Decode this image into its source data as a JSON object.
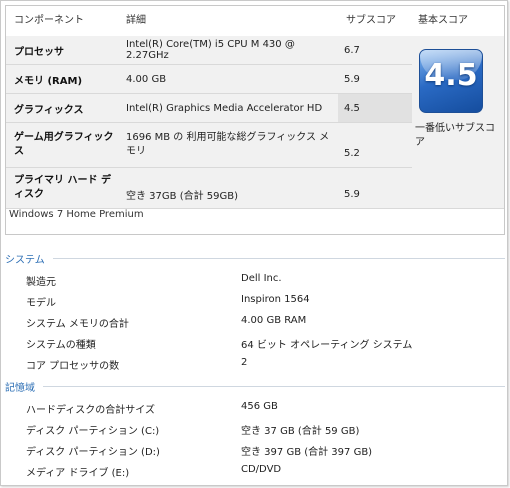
{
  "columns": {
    "component": "コンポーネント",
    "detail": "詳細",
    "subscore": "サブスコア",
    "basescore": "基本スコア"
  },
  "rows": [
    {
      "component": "プロセッサ",
      "detail": "Intel(R) Core(TM) i5 CPU M 430 @ 2.27GHz",
      "subscore": "6.7"
    },
    {
      "component": "メモリ (RAM)",
      "detail": "4.00 GB",
      "subscore": "5.9"
    },
    {
      "component": "グラフィックス",
      "detail": "Intel(R) Graphics Media Accelerator HD",
      "subscore": "4.5"
    },
    {
      "component": "ゲーム用グラフィックス",
      "detail": "1696 MB の 利用可能な総グラフィックス メモリ",
      "subscore": "5.2"
    },
    {
      "component": "プライマリ ハード ディスク",
      "detail": "空き 37GB (合計 59GB)",
      "subscore": "5.9"
    }
  ],
  "base_score": {
    "value": "4.5",
    "caption": "一番低いサブスコア"
  },
  "edition": "Windows 7 Home Premium",
  "system": {
    "heading": "システム",
    "items": [
      {
        "key": "製造元",
        "value": "Dell Inc."
      },
      {
        "key": "モデル",
        "value": "Inspiron 1564"
      },
      {
        "key": "システム メモリの合計",
        "value": "4.00 GB RAM"
      },
      {
        "key": "システムの種類",
        "value": "64 ビット オペレーティング システム"
      },
      {
        "key": "コア プロセッサの数",
        "value": "2"
      }
    ]
  },
  "storage": {
    "heading": "記憶域",
    "items": [
      {
        "key": "ハードディスクの合計サイズ",
        "value": "456 GB"
      },
      {
        "key": "ディスク パーティション (C:)",
        "value": "空き 37 GB (合計 59 GB)"
      },
      {
        "key": "ディスク パーティション (D:)",
        "value": "空き 397 GB (合計 397 GB)"
      },
      {
        "key": "メディア ドライブ (E:)",
        "value": "CD/DVD"
      }
    ]
  },
  "colors": {
    "section_heading": "#2d6fb5",
    "badge": "#2a6ac4"
  }
}
